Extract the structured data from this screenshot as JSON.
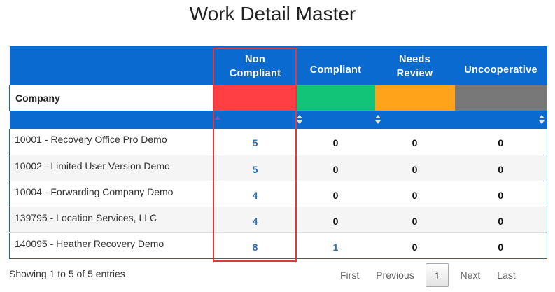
{
  "page": {
    "title": "Work Detail Master"
  },
  "table": {
    "columns": [
      {
        "label_line1": "Non",
        "label_line2": "Compliant",
        "swatch": "#ff3f44"
      },
      {
        "label": "Compliant",
        "swatch": "#12c477"
      },
      {
        "label_line1": "Needs",
        "label_line2": "Review",
        "swatch": "#ffa41a"
      },
      {
        "label": "Uncooperative",
        "swatch": "#787878"
      }
    ],
    "company_header": "Company",
    "rows": [
      {
        "company": "10001 - Recovery Office Pro Demo",
        "non_compliant": "5",
        "compliant": "0",
        "needs_review": "0",
        "uncooperative": "0"
      },
      {
        "company": "10002 - Limited User Version Demo",
        "non_compliant": "5",
        "compliant": "0",
        "needs_review": "0",
        "uncooperative": "0"
      },
      {
        "company": "10004 - Forwarding Company Demo",
        "non_compliant": "4",
        "compliant": "0",
        "needs_review": "0",
        "uncooperative": "0"
      },
      {
        "company": "139795 - Location Services, LLC",
        "non_compliant": "4",
        "compliant": "0",
        "needs_review": "0",
        "uncooperative": "0"
      },
      {
        "company": "140095 - Heather Recovery Demo",
        "non_compliant": "8",
        "compliant": "1",
        "needs_review": "0",
        "uncooperative": "0"
      }
    ]
  },
  "footer": {
    "info": "Showing 1 to 5 of 5 entries",
    "pagination": {
      "first": "First",
      "previous": "Previous",
      "current": "1",
      "next": "Next",
      "last": "Last"
    }
  },
  "colors": {
    "header_blue": "#0a6ad0",
    "link_blue": "#2f70b5",
    "highlight_red": "#e0383c"
  }
}
